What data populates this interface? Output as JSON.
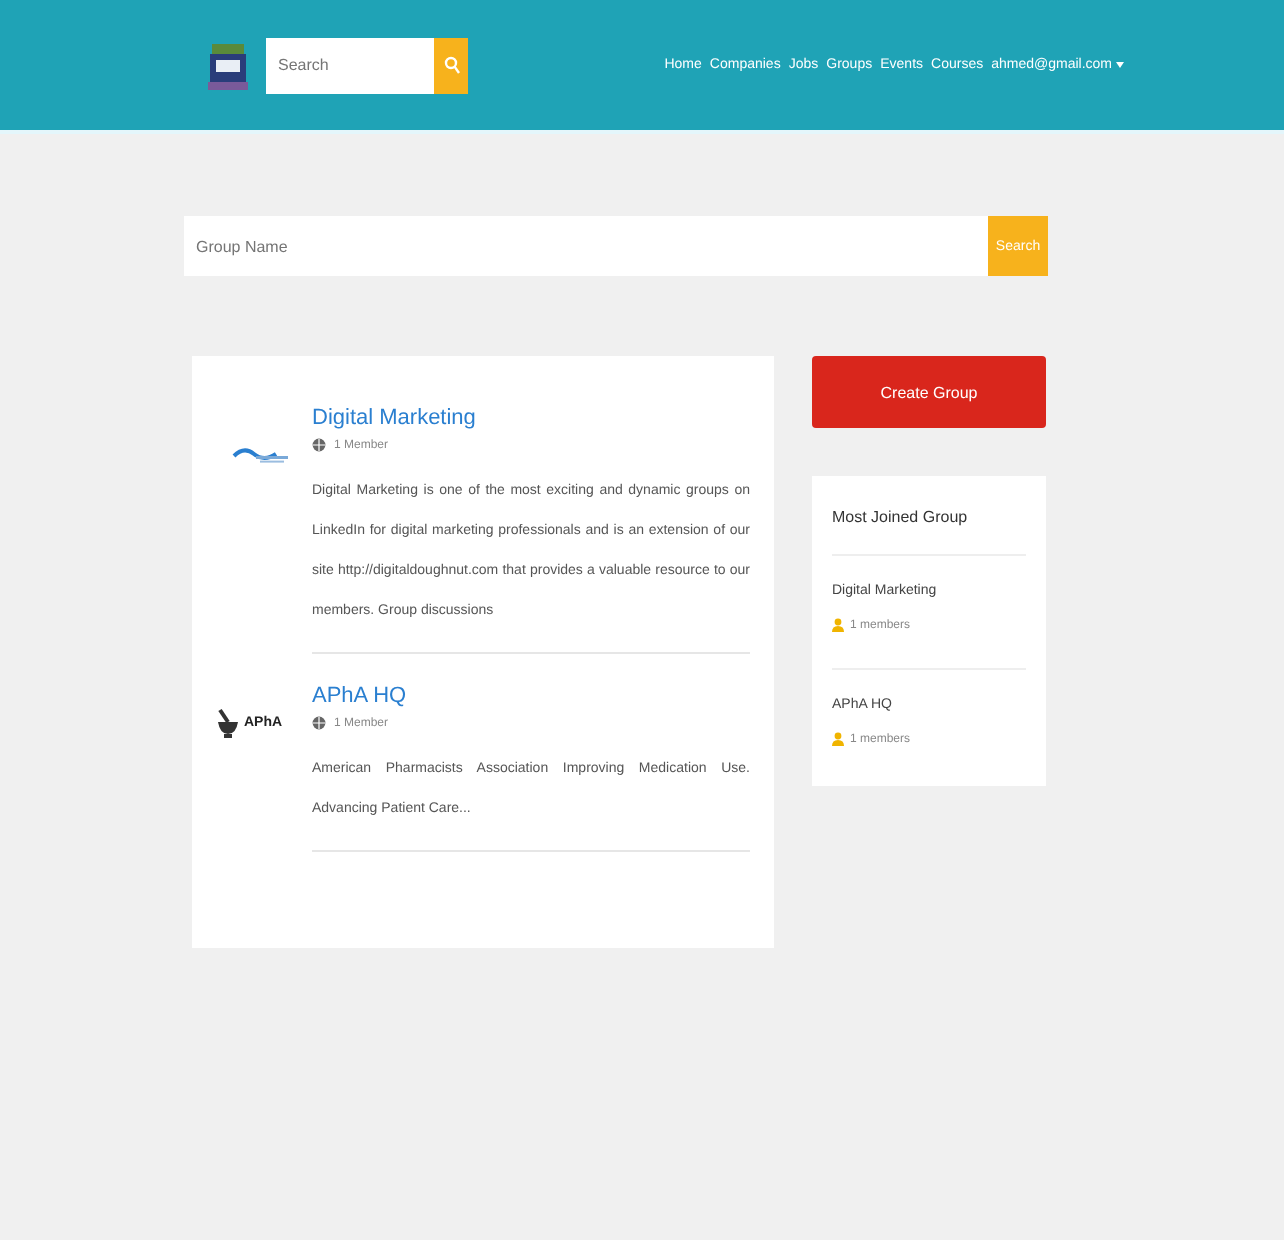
{
  "header": {
    "search": {
      "placeholder": "Search"
    },
    "nav": [
      {
        "label": "Home"
      },
      {
        "label": "Companies"
      },
      {
        "label": "Jobs"
      },
      {
        "label": "Groups"
      },
      {
        "label": "Events"
      },
      {
        "label": "Courses"
      },
      {
        "label": "ahmed@gmail.com",
        "kind": "dropdown"
      }
    ]
  },
  "group_search": {
    "placeholder": "Group Name",
    "button": "Search"
  },
  "groups": [
    {
      "name": "Digital Marketing",
      "kind": "wave",
      "members": "1 Member",
      "description": "Digital Marketing is one of the most exciting and dynamic groups on LinkedIn for digital marketing professionals and is an extension of our site http://digitaldoughnut.com that provides a valuable resource to our members. Group discussions"
    },
    {
      "name": "APhA HQ",
      "kind": "apha",
      "logo_text": "APhA",
      "members": "1 Member",
      "description": "American Pharmacists Association Improving Medication Use. Advancing Patient Care..."
    }
  ],
  "create_button": "Create Group",
  "most_joined": {
    "title": "Most Joined Group",
    "items": [
      {
        "name": "Digital Marketing",
        "members": "1 members"
      },
      {
        "name": "APhA HQ",
        "members": "1 members"
      }
    ]
  }
}
